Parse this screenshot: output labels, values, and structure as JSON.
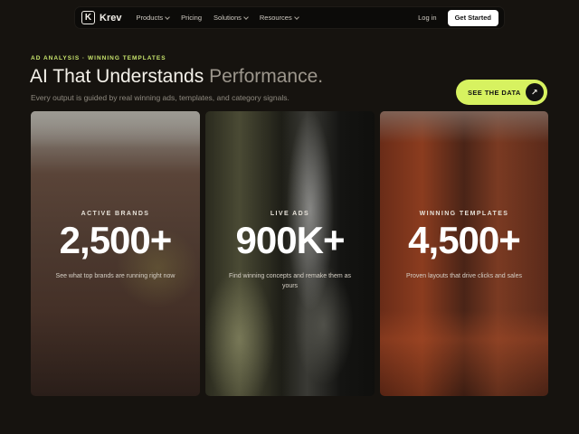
{
  "nav": {
    "logo_mark": "K",
    "brand": "Krev",
    "links": [
      "Products",
      "Pricing",
      "Solutions",
      "Resources"
    ],
    "login": "Log in",
    "cta": "Get Started"
  },
  "hero": {
    "eyebrow": "AD ANALYSIS · WINNING TEMPLATES",
    "headline_main": "AI That Understands ",
    "headline_muted": "Performance.",
    "subline": "Every output is guided by real winning ads, templates, and category signals.",
    "see_button": "SEE THE DATA",
    "arrow_icon": "arrow-up-right-icon"
  },
  "cards": [
    {
      "label": "ACTIVE BRANDS",
      "value": "2,500+",
      "desc": "See what top brands are running right now"
    },
    {
      "label": "LIVE ADS",
      "value": "900K+",
      "desc": "Find winning concepts and remake them as yours"
    },
    {
      "label": "WINNING TEMPLATES",
      "value": "4,500+",
      "desc": "Proven layouts that drive clicks and sales"
    }
  ],
  "colors": {
    "accent": "#d7f260",
    "background": "#16130f"
  }
}
